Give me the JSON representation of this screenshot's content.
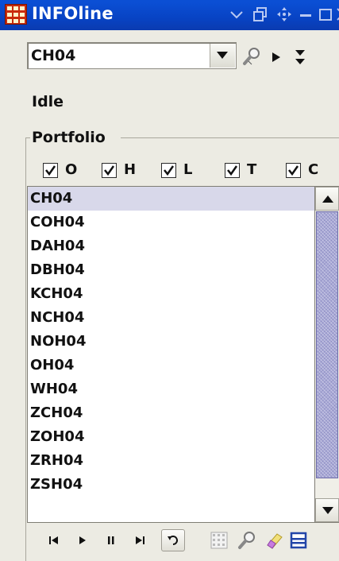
{
  "window": {
    "title": "INFOline"
  },
  "symbol": {
    "value": "CH04"
  },
  "status": "Idle",
  "portfolio": {
    "label": "Portfolio",
    "filters": [
      {
        "label": "O",
        "checked": true
      },
      {
        "label": "H",
        "checked": true
      },
      {
        "label": "L",
        "checked": true
      },
      {
        "label": "T",
        "checked": true
      },
      {
        "label": "C",
        "checked": true
      }
    ],
    "items": [
      "CH04",
      "COH04",
      "DAH04",
      "DBH04",
      "KCH04",
      "NCH04",
      "NOH04",
      "OH04",
      "WH04",
      "ZCH04",
      "ZOH04",
      "ZRH04",
      "ZSH04"
    ],
    "selected_index": 0
  },
  "icons": {
    "app": "grid-app-icon",
    "minimize_tray": "chevron-down-icon",
    "copy": "copy-window-icon",
    "move": "move-icon",
    "minimize": "minimize-icon",
    "maximize": "maximize-icon",
    "close": "close-icon",
    "search": "magnifier-icon",
    "play": "play-icon",
    "collapse": "collapse-icon",
    "first": "skip-first-icon",
    "pause": "pause-icon",
    "last": "skip-last-icon",
    "loop": "loop-icon",
    "grid": "grid-icon",
    "eraser": "eraser-icon",
    "panel": "panel-icon"
  },
  "colors": {
    "titlebar": "#0843c4",
    "selection": "#d8d8ea",
    "scroll_thumb": "#a8a8d6",
    "window_bg": "#ecebe3"
  }
}
